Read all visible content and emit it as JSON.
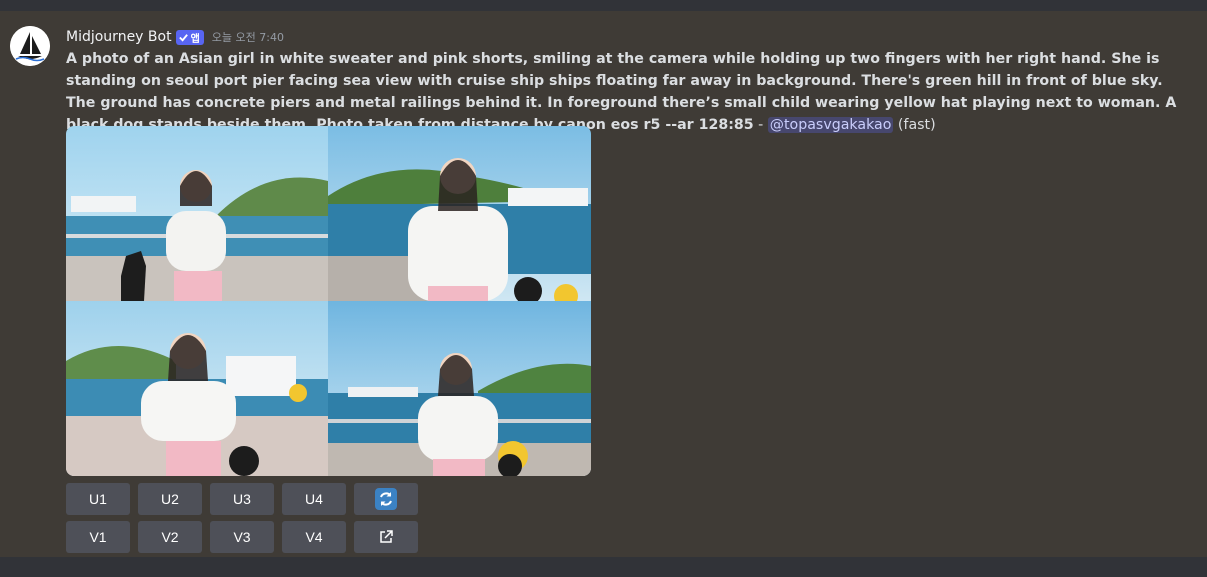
{
  "message": {
    "username": "Midjourney Bot",
    "badge": "앱",
    "timestamp_day": "오늘 오전",
    "timestamp_time": "7:40",
    "prompt": "A photo of an Asian girl in white sweater and pink shorts, smiling at the camera while holding up two fingers with her right hand. She is standing on seoul port pier facing sea view with cruise ship ships floating far away in background. There's green hill in front of blue sky. The ground has concrete piers and metal railings behind it. In foreground there’s small child wearing yellow hat playing next to woman. A black dog stands beside them. Photo taken from distance by canon eos r5 --ar 128:85",
    "separator": " - ",
    "mention": "@topasvgakakao",
    "speed": " (fast)"
  },
  "buttons": {
    "row1": [
      "U1",
      "U2",
      "U3",
      "U4"
    ],
    "row2": [
      "V1",
      "V2",
      "V3",
      "V4"
    ]
  },
  "icons": {
    "avatar": "sailboat-logo",
    "verified": "checkmark-icon",
    "reroll": "refresh-icon",
    "open_external": "external-link-icon"
  },
  "colors": {
    "background": "#3f3b36",
    "button": "#4e5058",
    "mention": "#5865f2",
    "reroll": "#3b82c4"
  }
}
